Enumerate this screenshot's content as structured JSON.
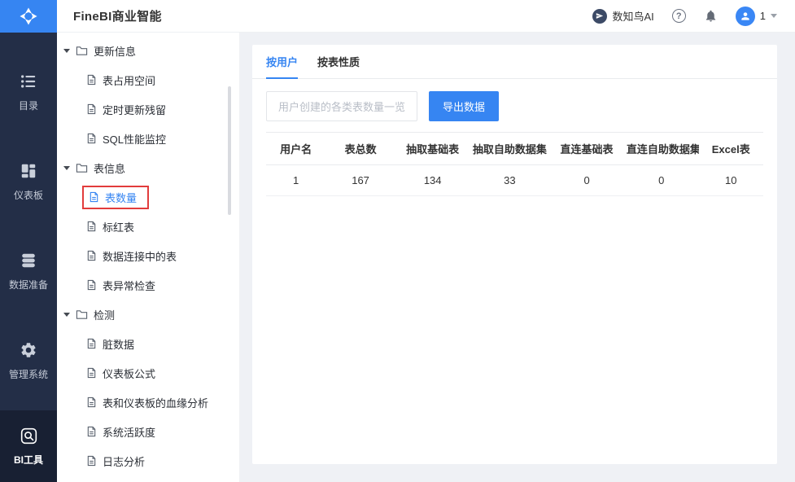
{
  "colors": {
    "accent": "#3685f2",
    "selected_outline": "#e23c3c",
    "sidenav_bg": "#232e47"
  },
  "icons": {
    "help_glyph": "?"
  },
  "header": {
    "title": "FineBI商业智能",
    "ai_label": "数知鸟AI",
    "user_badge": "1"
  },
  "nav": {
    "items": [
      {
        "label": "目录"
      },
      {
        "label": "仪表板"
      },
      {
        "label": "数据准备"
      },
      {
        "label": "管理系统"
      },
      {
        "label": "BI工具"
      }
    ]
  },
  "tree": {
    "groups": [
      {
        "label": "更新信息",
        "items": [
          "表占用空间",
          "定时更新残留",
          "SQL性能监控"
        ]
      },
      {
        "label": "表信息",
        "items": [
          "表数量",
          "标红表",
          "数据连接中的表",
          "表异常检查"
        ]
      },
      {
        "label": "检测",
        "items": [
          "脏数据",
          "仪表板公式",
          "表和仪表板的血缘分析",
          "系统活跃度",
          "日志分析"
        ]
      }
    ],
    "selected_item": "表数量"
  },
  "main": {
    "tabs": [
      {
        "label": "按用户"
      },
      {
        "label": "按表性质"
      }
    ],
    "description": "用户创建的各类表数量一览",
    "export_button": "导出数据",
    "table": {
      "headers": [
        "用户名",
        "表总数",
        "抽取基础表",
        "抽取自助数据集",
        "直连基础表",
        "直连自助数据集",
        "Excel表"
      ],
      "rows": [
        [
          "1",
          "167",
          "134",
          "33",
          "0",
          "0",
          "10"
        ]
      ]
    }
  }
}
